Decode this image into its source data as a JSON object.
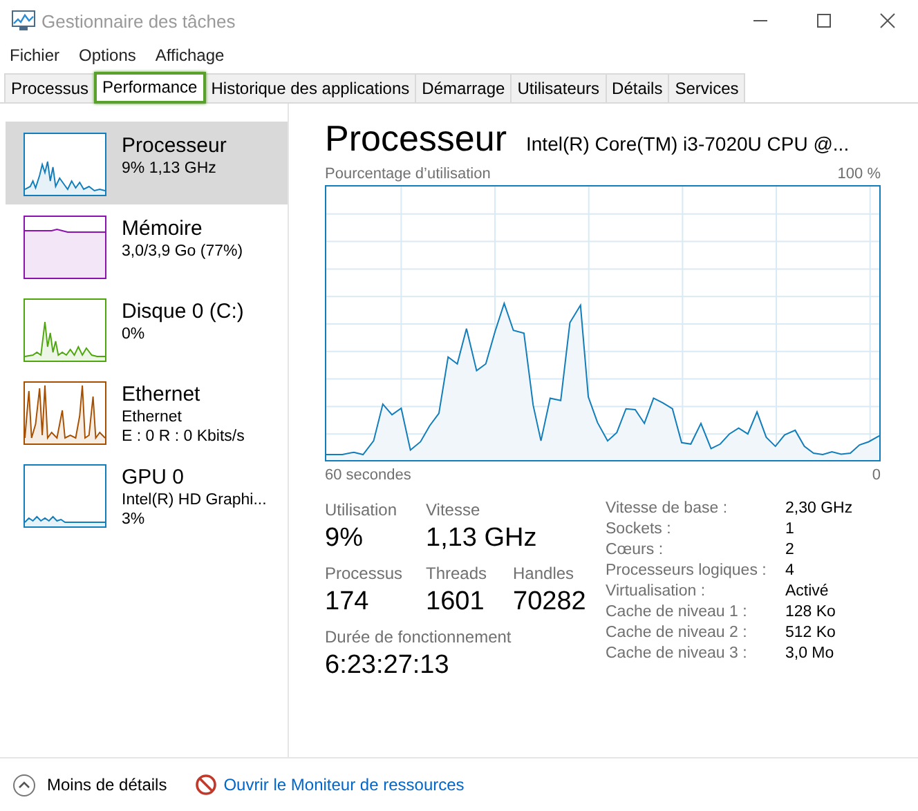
{
  "window": {
    "title": "Gestionnaire des tâches"
  },
  "menu": [
    "Fichier",
    "Options",
    "Affichage"
  ],
  "tabs": [
    {
      "label": "Processus",
      "selected": false
    },
    {
      "label": "Performance",
      "selected": true
    },
    {
      "label": "Historique des applications",
      "selected": false
    },
    {
      "label": "Démarrage",
      "selected": false
    },
    {
      "label": "Utilisateurs",
      "selected": false
    },
    {
      "label": "Détails",
      "selected": false
    },
    {
      "label": "Services",
      "selected": false
    }
  ],
  "sidebar": {
    "items": [
      {
        "kind": "cpu",
        "name": "Processeur",
        "lines": [
          "9%  1,13 GHz"
        ],
        "color": "#117dbb",
        "selected": true
      },
      {
        "kind": "memory",
        "name": "Mémoire",
        "lines": [
          "3,0/3,9 Go (77%)"
        ],
        "color": "#8b12ae",
        "selected": false
      },
      {
        "kind": "disk",
        "name": "Disque 0 (C:)",
        "lines": [
          "0%"
        ],
        "color": "#4da60c",
        "selected": false
      },
      {
        "kind": "ethernet",
        "name": "Ethernet",
        "lines": [
          "Ethernet",
          "E : 0 R : 0 Kbits/s"
        ],
        "color": "#a74f01",
        "selected": false
      },
      {
        "kind": "gpu",
        "name": "GPU 0",
        "lines": [
          "Intel(R) HD Graphi...",
          "3%"
        ],
        "color": "#117dbb",
        "selected": false
      }
    ]
  },
  "detail": {
    "title": "Processeur",
    "model": "Intel(R) Core(TM) i3-7020U CPU @...",
    "graph": {
      "label": "Pourcentage d’utilisation",
      "max_label": "100 %",
      "time_label": "60 secondes",
      "end_label": "0"
    },
    "stats": [
      {
        "label": "Utilisation",
        "value": "9%"
      },
      {
        "label": "Vitesse",
        "value": "1,13 GHz"
      },
      {
        "label": "Processus",
        "value": "174"
      },
      {
        "label": "Threads",
        "value": "1601"
      },
      {
        "label": "Handles",
        "value": "70282"
      },
      {
        "label": "Durée de fonctionnement",
        "value": "6:23:27:13"
      }
    ],
    "specs": [
      {
        "label": "Vitesse de base :",
        "value": "2,30 GHz"
      },
      {
        "label": "Sockets :",
        "value": "1"
      },
      {
        "label": "Cœurs :",
        "value": "2"
      },
      {
        "label": "Processeurs logiques :",
        "value": "4"
      },
      {
        "label": "Virtualisation :",
        "value": "Activé"
      },
      {
        "label": "Cache de niveau 1 :",
        "value": "128 Ko"
      },
      {
        "label": "Cache de niveau 2 :",
        "value": "512 Ko"
      },
      {
        "label": "Cache de niveau 3 :",
        "value": "3,0 Mo"
      }
    ]
  },
  "footer": {
    "less_details": "Moins de détails",
    "resource_monitor": "Ouvrir le Moniteur de ressources"
  }
}
